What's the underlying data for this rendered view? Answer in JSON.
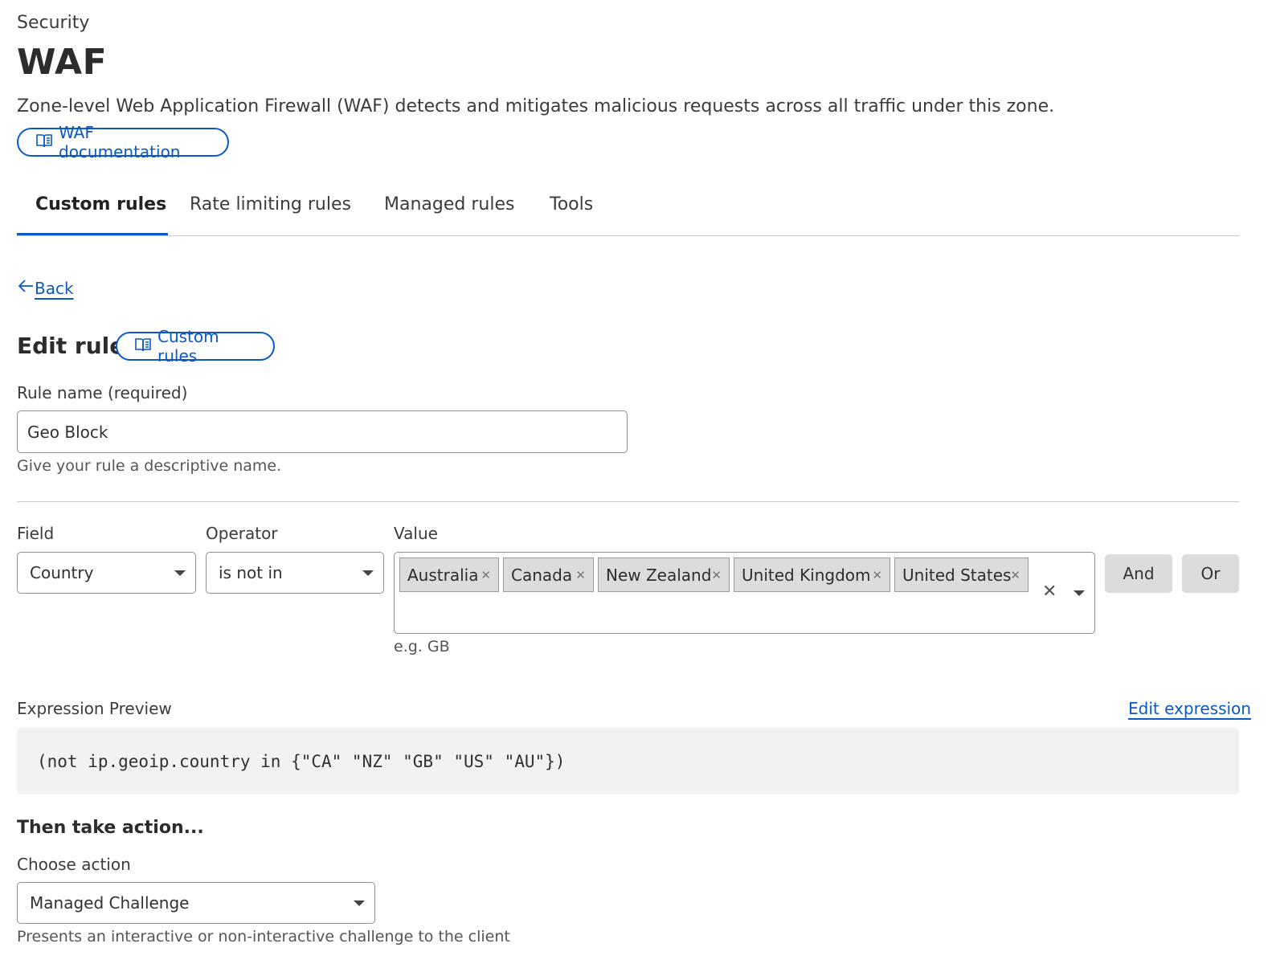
{
  "header": {
    "breadcrumb": "Security",
    "title": "WAF",
    "description": "Zone-level Web Application Firewall (WAF) detects and mitigates malicious requests across all traffic under this zone.",
    "doc_link": "WAF documentation"
  },
  "tabs": [
    {
      "label": "Custom rules",
      "active": true
    },
    {
      "label": "Rate limiting rules",
      "active": false
    },
    {
      "label": "Managed rules",
      "active": false
    },
    {
      "label": "Tools",
      "active": false
    }
  ],
  "back_label": "Back",
  "edit_rule": {
    "title": "Edit rule",
    "doc_link": "Custom rules",
    "rule_name_label": "Rule name (required)",
    "rule_name_value": "Geo Block",
    "rule_name_hint": "Give your rule a descriptive name."
  },
  "condition": {
    "field_label": "Field",
    "field_value": "Country",
    "operator_label": "Operator",
    "operator_value": "is not in",
    "value_label": "Value",
    "values": [
      "Australia",
      "Canada",
      "New Zealand",
      "United Kingdom",
      "United States"
    ],
    "value_hint": "e.g. GB",
    "and_label": "And",
    "or_label": "Or"
  },
  "expression": {
    "label": "Expression Preview",
    "edit_link": "Edit expression",
    "code": "(not ip.geoip.country in {\"CA\" \"NZ\" \"GB\" \"US\" \"AU\"})"
  },
  "action": {
    "heading": "Then take action...",
    "choose_label": "Choose action",
    "selected": "Managed Challenge",
    "hint": "Presents an interactive or non-interactive challenge to the client"
  },
  "icons": {
    "doc": "book-icon",
    "back": "arrow-left-icon",
    "remove": "close-icon",
    "dropdown": "chevron-down-icon"
  },
  "colors": {
    "accent": "#0a59c4",
    "text": "#313131",
    "chip_bg": "#dcdcdc",
    "code_bg": "#f2f2f2"
  }
}
